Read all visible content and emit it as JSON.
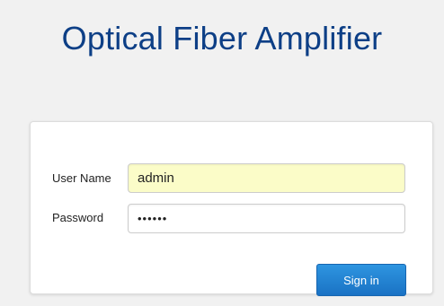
{
  "header": {
    "title": "Optical Fiber Amplifier"
  },
  "login": {
    "username_label": "User Name",
    "username_value": "admin",
    "password_label": "Password",
    "password_value": "••••••",
    "signin_label": "Sign in"
  },
  "colors": {
    "title": "#0d3f86",
    "autofill_background": "#fbfcc8",
    "button": "#1f7fd0"
  }
}
